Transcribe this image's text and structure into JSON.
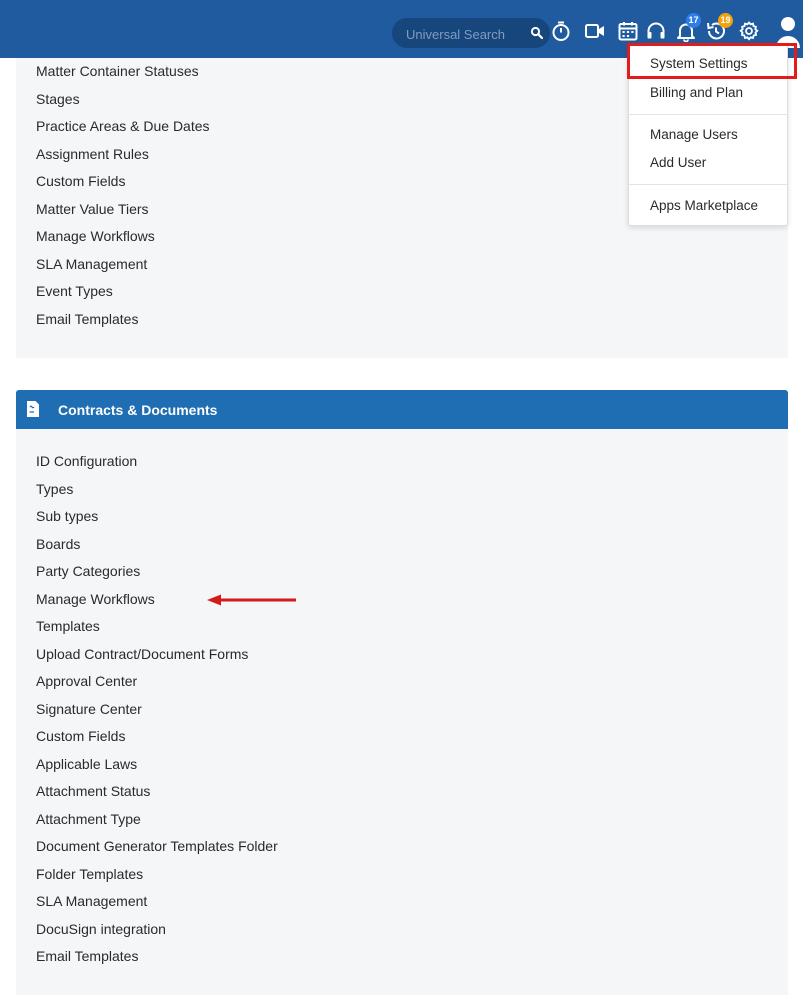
{
  "topbar": {
    "search_placeholder": "Universal Search",
    "icons": [
      "search-icon",
      "timer-icon",
      "video-icon",
      "calendar-icon",
      "headset-icon",
      "bell-icon",
      "refresh-clock-icon",
      "gear-icon",
      "user-avatar-icon"
    ],
    "notifications_badge": "17",
    "reminders_badge": "19",
    "accent_color": "#1f5b9e"
  },
  "matters_section": {
    "items": [
      "Matter Container Statuses",
      "Stages",
      "Practice Areas & Due Dates",
      "Assignment Rules",
      "Custom Fields",
      "Matter Value Tiers",
      "Manage Workflows",
      "SLA Management",
      "Event Types",
      "Email Templates"
    ]
  },
  "contracts_section": {
    "title": "Contracts & Documents",
    "header_color": "#1f6db3",
    "items": [
      "ID Configuration",
      "Types",
      "Sub types",
      "Boards",
      "Party Categories",
      "Manage Workflows",
      "Templates",
      "Upload Contract/Document Forms",
      "Approval Center",
      "Signature Center",
      "Custom Fields",
      "Applicable Laws",
      "Attachment Status",
      "Attachment Type",
      "Document Generator Templates Folder",
      "Folder Templates",
      "SLA Management",
      "DocuSign integration",
      "Email Templates"
    ]
  },
  "dropdown": {
    "items": [
      "System Settings",
      "Billing and Plan",
      "Manage Users",
      "Add User",
      "Apps Marketplace"
    ],
    "highlight_color": "#e41b1b"
  }
}
